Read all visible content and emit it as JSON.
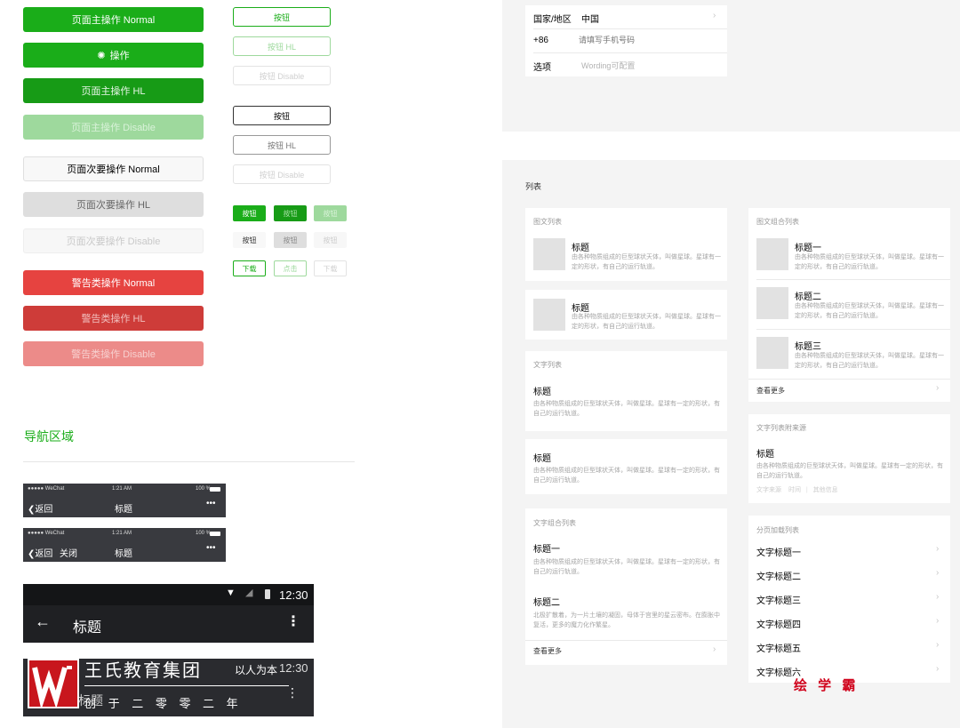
{
  "primary_buttons": {
    "normal": "页面主操作 Normal",
    "loading": "操作",
    "hl": "页面主操作 HL",
    "disable": "页面主操作 Disable"
  },
  "secondary_buttons": {
    "normal": "页面次要操作 Normal",
    "hl": "页面次要操作 HL",
    "disable": "页面次要操作 Disable"
  },
  "warn_buttons": {
    "normal": "警告类操作 Normal",
    "hl": "警告类操作 HL",
    "disable": "警告类操作 Disable"
  },
  "outline_green": {
    "normal": "按钮",
    "hl": "按钮 HL",
    "disable": "按钮 Disable"
  },
  "outline_black": {
    "normal": "按钮",
    "hl": "按钮 HL",
    "disable": "按钮 Disable"
  },
  "mini_buttons": {
    "green": [
      "按钮",
      "按钮",
      "按钮"
    ],
    "gray": [
      "按钮",
      "按钮",
      "按钮"
    ],
    "outline": [
      "下载",
      "点击",
      "下载"
    ]
  },
  "nav_section": {
    "title": "导航区域",
    "ios_status": {
      "carrier": "●●●●● WeChat",
      "time": "1:21 AM",
      "battery": "100 %"
    },
    "bar1": {
      "back": "返回",
      "title": "标题",
      "more": "•••"
    },
    "bar2": {
      "back": "返回",
      "close": "关闭",
      "title": "标题",
      "more": "•••"
    },
    "android_bar": {
      "time": "12:30",
      "title": "标题"
    },
    "android_bar2": {
      "time": "12:30",
      "title": "标题"
    }
  },
  "watermark": {
    "company": "王氏教育集团",
    "slogan": "以人为本",
    "founded": "创 于 二 零 零 二 年",
    "right": "绘 学 霸"
  },
  "form": {
    "country_label": "国家/地区",
    "country_value": "中国",
    "code": "+86",
    "phone_placeholder": "请填写手机号码",
    "option_label": "选项",
    "option_value": "Wording可配置"
  },
  "list_section": {
    "title": "列表",
    "media_list": {
      "label": "图文列表",
      "items": [
        {
          "title": "标题",
          "desc": "由各种物质组成的巨型球状天体，叫做星球。星球有一定的形状，有自己的运行轨道。"
        },
        {
          "title": "标题",
          "desc": "由各种物质组成的巨型球状天体，叫做星球。星球有一定的形状，有自己的运行轨道。"
        }
      ]
    },
    "text_list": {
      "label": "文字列表",
      "items": [
        {
          "title": "标题",
          "desc": "由各种物质组成的巨型球状天体，叫做星球。星球有一定的形状，有自己的运行轨道。"
        },
        {
          "title": "标题",
          "desc": "由各种物质组成的巨型球状天体，叫做星球。星球有一定的形状，有自己的运行轨道。"
        }
      ]
    },
    "text_combo": {
      "label": "文字组合列表",
      "items": [
        {
          "title": "标题一",
          "desc": "由各种物质组成的巨型球状天体，叫做星球。星球有一定的形状，有自己的运行轨道。"
        },
        {
          "title": "标题二",
          "desc": "北极扩散着，为一片土壤的凝固，母体于宫里的星云密布。在膨胀中复活，更多的魔力化作繁星。"
        }
      ],
      "more": "查看更多"
    },
    "media_combo": {
      "label": "图文组合列表",
      "items": [
        {
          "title": "标题一",
          "desc": "由各种物质组成的巨型球状天体，叫做星球。星球有一定的形状，有自己的运行轨道。"
        },
        {
          "title": "标题二",
          "desc": "由各种物质组成的巨型球状天体，叫做星球。星球有一定的形状，有自己的运行轨道。"
        },
        {
          "title": "标题三",
          "desc": "由各种物质组成的巨型球状天体，叫做星球。星球有一定的形状，有自己的运行轨道。"
        }
      ],
      "more": "查看更多"
    },
    "text_source": {
      "label": "文字列表附来源",
      "title": "标题",
      "desc": "由各种物质组成的巨型球状天体，叫做星球。星球有一定的形状，有自己的运行轨道。",
      "meta": [
        "文字来源",
        "时间",
        "其他信息"
      ]
    },
    "paged": {
      "label": "分页加载列表",
      "items": [
        "文字标题一",
        "文字标题二",
        "文字标题三",
        "文字标题四",
        "文字标题五",
        "文字标题六"
      ]
    }
  },
  "colors": {
    "green": "#1aad19",
    "red": "#e64340",
    "nav_dark": "#393a3f",
    "android_dark": "#1f2023",
    "panel_bg": "#f4f4f4"
  }
}
